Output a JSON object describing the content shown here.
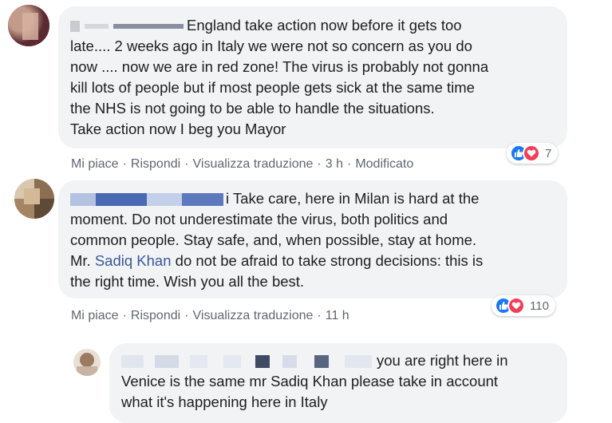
{
  "comments": [
    {
      "text_lines": [
        "England take action now before it gets too",
        "late.... 2 weeks ago in Italy we were not so concern as you do",
        "now .... now we are in red zone! The virus is probably not gonna",
        "kill lots of people but if most people gets sick at the same time",
        "the NHS is not going to be able to handle the situations.",
        "Take action now I beg you Mayor"
      ],
      "actions": {
        "like": "Mi piace",
        "reply": "Rispondi",
        "translate": "Visualizza traduzione",
        "time": "3 h",
        "edited": "Modificato"
      },
      "reaction_count": "7"
    },
    {
      "text_lines": [
        "i Take care, here in Milan is hard at the",
        "moment. Do not underestimate the virus, both politics and",
        "common people. Stay safe, and, when possible, stay at home.",
        "do not be afraid to take strong decisions: this is",
        "the right time. Wish you all the best."
      ],
      "mention_prefix": "Mr.",
      "mention": "Sadiq Khan",
      "actions": {
        "like": "Mi piace",
        "reply": "Rispondi",
        "translate": "Visualizza traduzione",
        "time": "11 h"
      },
      "reaction_count": "110"
    },
    {
      "text_lines": [
        "you are right here in",
        "Venice is the same mr Sadiq Khan please take in account",
        "what it's happening here in Italy"
      ]
    }
  ],
  "colors": {
    "bubble": "#f2f3f5",
    "link": "#385898",
    "like": "#1877f2",
    "love": "#f33e58",
    "meta": "#616770"
  },
  "icons": {
    "like": "thumbs-up-icon",
    "love": "heart-icon"
  }
}
